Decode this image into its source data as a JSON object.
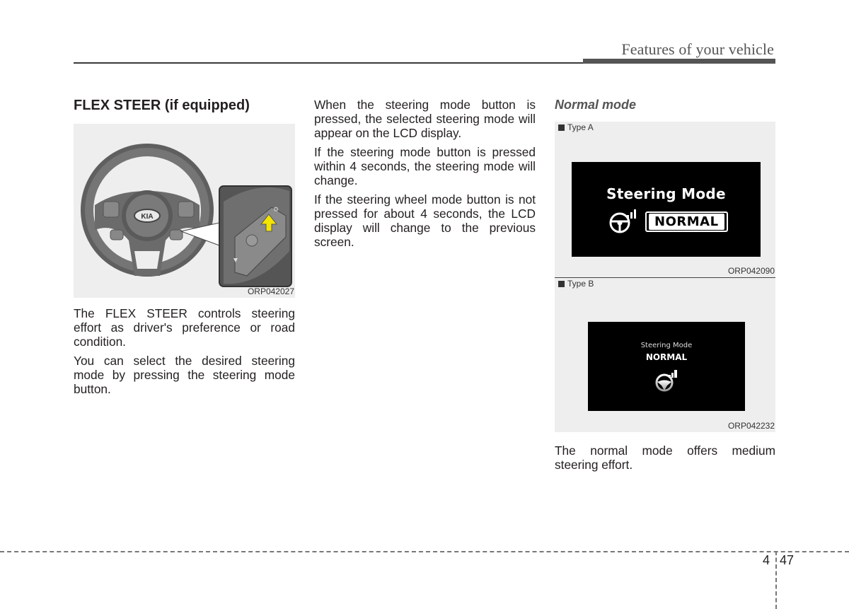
{
  "header": {
    "section_title": "Features of your vehicle"
  },
  "column1": {
    "title": "FLEX STEER (if equipped)",
    "figure": {
      "code": "ORP042027",
      "brand_badge": "KIA",
      "description": "steering wheel with close-up of steering mode button, yellow arrow indicating button"
    },
    "paragraphs": [
      "The FLEX STEER controls steering effort as driver's preference or road condition.",
      "You can select the desired steering mode by pressing the steering mode button."
    ]
  },
  "column2": {
    "paragraphs": [
      "When the steering mode button is pressed, the selected steering mode will appear on the LCD display.",
      "If the steering mode button is pressed within 4 seconds, the steering mode will change.",
      "If the steering wheel mode button is not pressed for about 4 seconds, the LCD display will change to the previous screen."
    ]
  },
  "column3": {
    "subtitle": "Normal mode",
    "figure_a": {
      "type_label": "Type A",
      "lcd_title": "Steering Mode",
      "lcd_mode": "NORMAL",
      "code": "ORP042090"
    },
    "figure_b": {
      "type_label": "Type B",
      "lcd_title": "Steering Mode",
      "lcd_mode": "NORMAL",
      "code": "ORP042232"
    },
    "paragraphs": [
      "The normal mode offers medium steering effort."
    ]
  },
  "footer": {
    "chapter": "4",
    "page": "47"
  },
  "colors": {
    "accent_arrow": "#f5e400",
    "header_bar": "#555555",
    "figure_bg": "#eeeeee"
  }
}
